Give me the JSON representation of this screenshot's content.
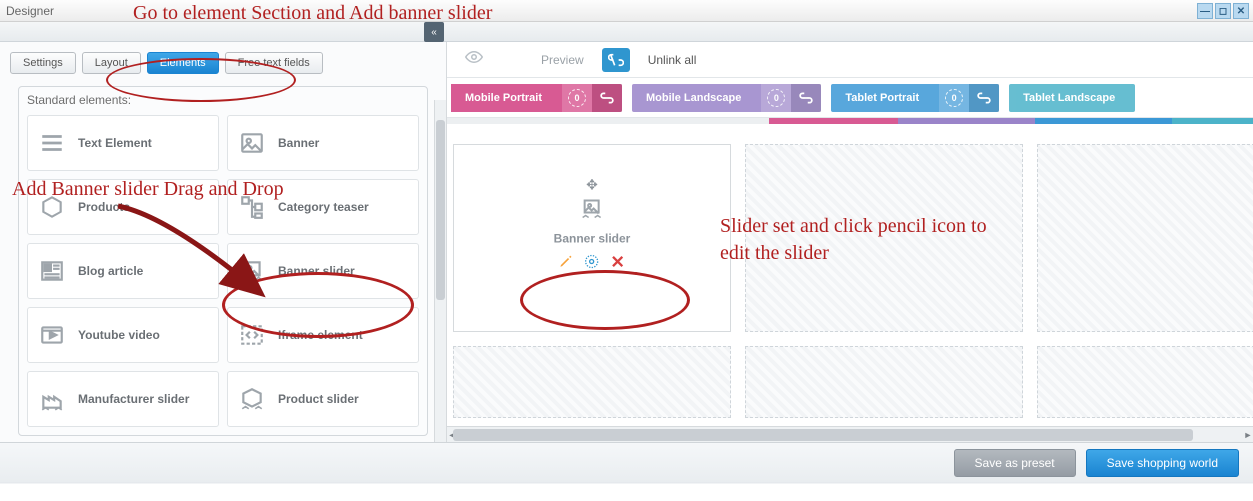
{
  "window": {
    "title": "Designer"
  },
  "tabs": {
    "settings": "Settings",
    "layout": "Layout",
    "elements": "Elements",
    "freetext": "Free text fields"
  },
  "panel": {
    "title": "Standard elements:"
  },
  "elements": {
    "text": "Text Element",
    "banner": "Banner",
    "products": "Products",
    "category": "Category teaser",
    "blog": "Blog article",
    "banner_slider": "Banner slider",
    "youtube": "Youtube video",
    "iframe": "Iframe element",
    "manufacturer": "Manufacturer slider",
    "product_slider": "Product slider"
  },
  "right_toolbar": {
    "preview": "Preview",
    "unlink": "Unlink all"
  },
  "devices": {
    "d0": {
      "name": "Mobile Portrait",
      "badge": "0"
    },
    "d1": {
      "name": "Mobile Landscape",
      "badge": "0"
    },
    "d2": {
      "name": "Tablet Portrait",
      "badge": "0"
    },
    "d3": {
      "name": "Tablet Landscape"
    }
  },
  "canvas": {
    "widget_name": "Banner slider"
  },
  "footer": {
    "preset": "Save as preset",
    "save": "Save shopping world"
  },
  "annotations": {
    "top": "Go to element Section and Add banner slider",
    "left": "Add Banner slider  Drag and Drop",
    "right_line1": "Slider set and click pencil icon to",
    "right_line2": "edit the slider"
  }
}
